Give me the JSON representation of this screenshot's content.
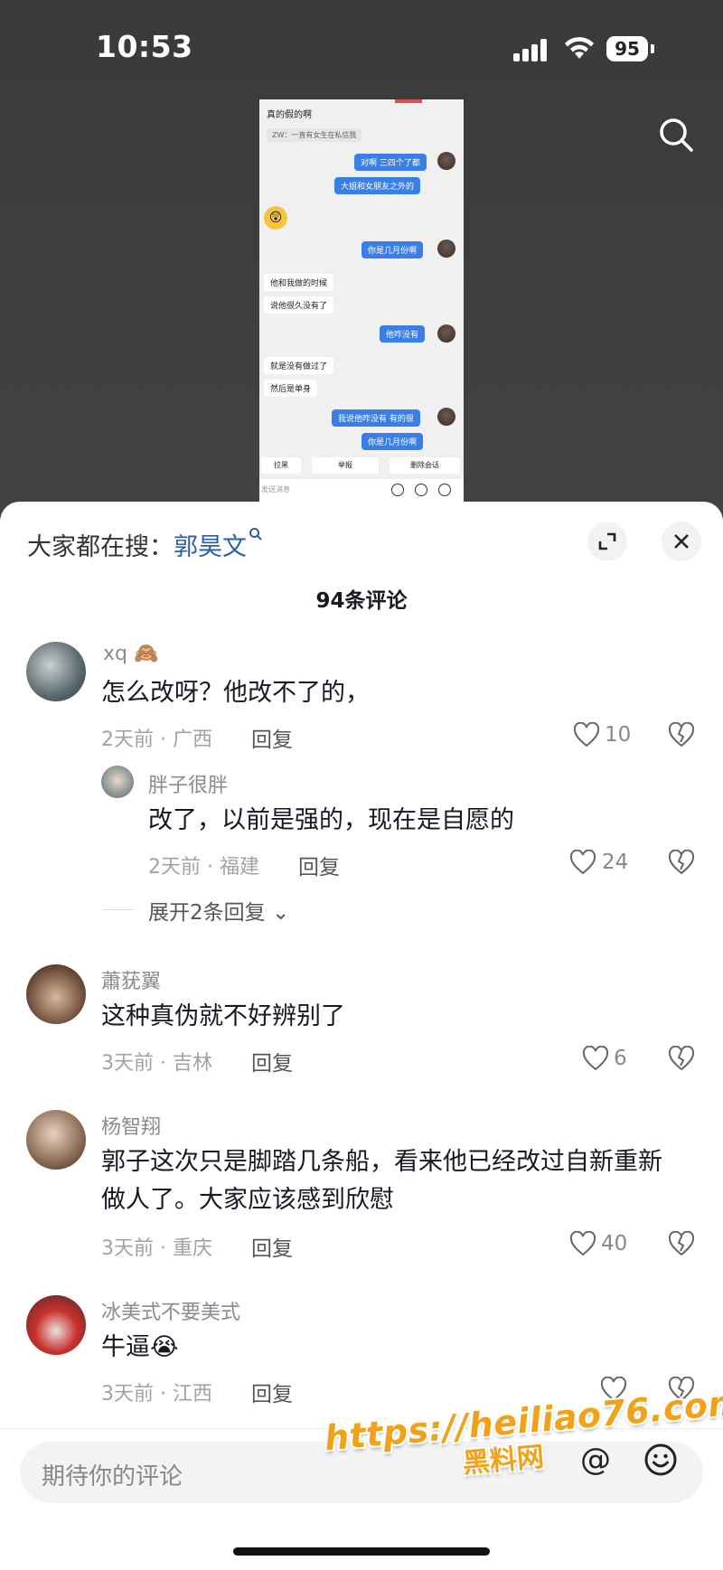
{
  "status_bar": {
    "time": "10:53",
    "battery": "95"
  },
  "chat_preview": {
    "top_text": "真的假的啊",
    "zw_tip": "ZW：一直有女生在私信我",
    "messages": [
      {
        "side": "me",
        "text": "对啊 三四个了都"
      },
      {
        "side": "me",
        "text": "大姐和女朋友之外的"
      },
      {
        "side": "me",
        "text": "你是几月份啊"
      },
      {
        "side": "other",
        "text": "他和我做的时候"
      },
      {
        "side": "other",
        "text": "说他很久没有了"
      },
      {
        "side": "me",
        "text": "他咋没有"
      },
      {
        "side": "other",
        "text": "就是没有做过了"
      },
      {
        "side": "other",
        "text": "然后是单身"
      },
      {
        "side": "me",
        "text": "我说他咋没有 有的很"
      },
      {
        "side": "me",
        "text": "你是几月份啊"
      }
    ],
    "actions": [
      "拉黑",
      "举报",
      "删除会话"
    ],
    "input_placeholder": "发送消息"
  },
  "sheet": {
    "hot_prefix": "大家都在搜：",
    "hot_keyword": "郭昊文",
    "comment_count": "94条评论"
  },
  "comments": [
    {
      "user": "xq",
      "user_emoji": "🙈",
      "text": "怎么改呀？他改不了的，",
      "meta": "2天前 · 广西",
      "reply": "回复",
      "likes": "10"
    },
    {
      "user": "胖子很胖",
      "text": "改了，以前是强的，现在是自愿的",
      "meta": "2天前 · 福建",
      "reply": "回复",
      "likes": "24"
    },
    {
      "user": "蕭莸翼",
      "text": "这种真伪就不好辨别了",
      "meta": "3天前 · 吉林",
      "reply": "回复",
      "likes": "6"
    },
    {
      "user": "杨智翔",
      "text_line1": "郭子这次只是脚踏几条船，看来他已经改过自新重新",
      "text_line2": "做人了。大家应该感到欣慰",
      "meta": "3天前 · 重庆",
      "reply": "回复",
      "likes": "40"
    },
    {
      "user": "冰美式不要美式",
      "text": "牛逼😭",
      "meta": "3天前 · 江西",
      "reply": "回复",
      "likes": ""
    }
  ],
  "expand_replies": "展开2条回复",
  "composer": {
    "placeholder": "期待你的评论",
    "at_label": "@"
  },
  "watermark": {
    "line1": "https://heiliao76.com",
    "line2": "黑料网"
  },
  "icons": [
    "search-icon",
    "expand-icon",
    "close-icon",
    "heart-icon",
    "broken-heart-icon",
    "at-icon",
    "emoji-icon",
    "wifi-icon",
    "signal-icon"
  ]
}
